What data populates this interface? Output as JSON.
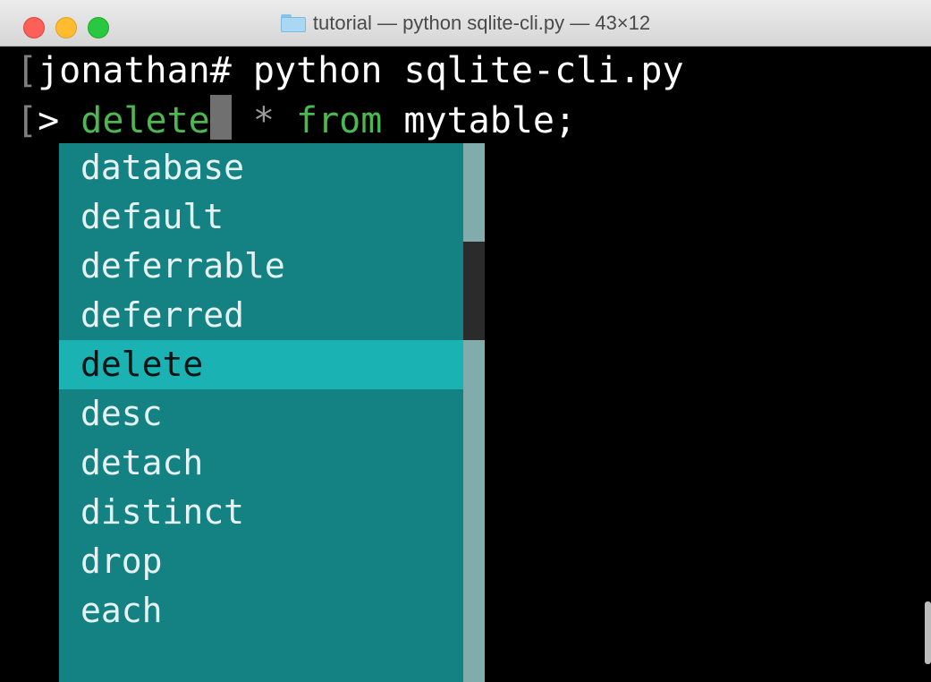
{
  "window": {
    "title": "tutorial — python sqlite-cli.py — 43×12",
    "folder_icon": "folder-icon"
  },
  "terminal": {
    "line1": {
      "bracket": "[",
      "text": "jonathan# python sqlite-cli.py"
    },
    "line2": {
      "bracket": "[",
      "prompt": "> ",
      "keyword": "delete",
      "star": " * ",
      "from": "from",
      "rest": " mytable;"
    }
  },
  "completion_menu": {
    "selected": "delete",
    "items": [
      "database",
      "default",
      "deferrable",
      "deferred",
      "delete",
      "desc",
      "detach",
      "distinct",
      "drop",
      "each"
    ]
  },
  "colors": {
    "keyword": "#4cb850",
    "menu_bg": "#148282",
    "menu_selected": "#1ab2b2"
  }
}
